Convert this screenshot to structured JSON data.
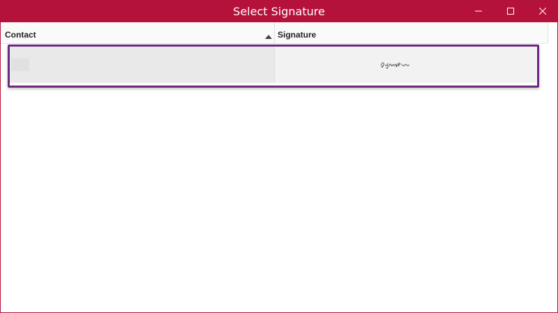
{
  "window": {
    "title": "Select Signature",
    "accent_color": "#b5123b",
    "controls": [
      "minimize-icon",
      "maximize-icon",
      "close-icon"
    ]
  },
  "grid": {
    "columns": [
      {
        "label": "Contact"
      },
      {
        "label": "Signature",
        "sorted": "ascending"
      }
    ],
    "rows": [
      {
        "contact": "",
        "signature_image": "Signature",
        "selected": true
      }
    ],
    "selection_color": "#6a2a7e"
  }
}
